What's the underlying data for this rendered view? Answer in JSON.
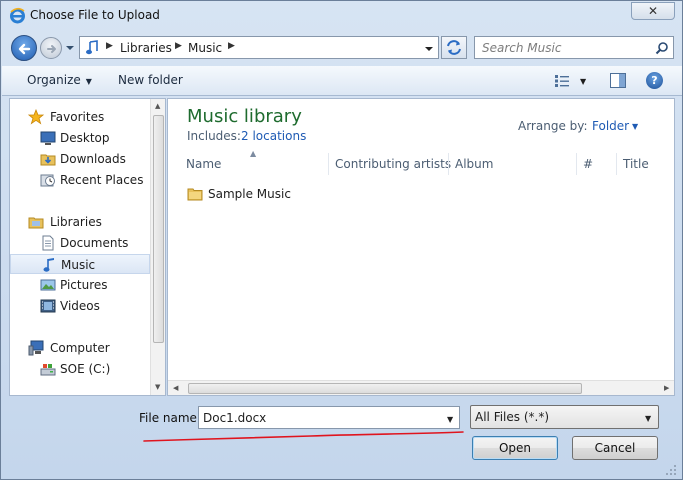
{
  "window": {
    "title": "Choose File to Upload",
    "close_symbol": "✕"
  },
  "address": {
    "crumbs": [
      "Libraries",
      "Music"
    ],
    "search_placeholder": "Search Music"
  },
  "toolbar": {
    "organize": "Organize",
    "new_folder": "New folder",
    "help_symbol": "?"
  },
  "nav": {
    "items": [
      {
        "label": "Favorites",
        "icon": "star-icon"
      },
      {
        "label": "Desktop",
        "icon": "desktop-icon"
      },
      {
        "label": "Downloads",
        "icon": "downloads-folder-icon"
      },
      {
        "label": "Recent Places",
        "icon": "recent-places-icon"
      },
      {
        "label": "Libraries",
        "icon": "libraries-icon"
      },
      {
        "label": "Documents",
        "icon": "documents-icon"
      },
      {
        "label": "Music",
        "icon": "music-note-icon"
      },
      {
        "label": "Pictures",
        "icon": "pictures-icon"
      },
      {
        "label": "Videos",
        "icon": "videos-icon"
      },
      {
        "label": "Computer",
        "icon": "computer-icon"
      },
      {
        "label": "SOE (C:)",
        "icon": "drive-icon"
      }
    ],
    "selected": "Music"
  },
  "library": {
    "title": "Music library",
    "includes_label": "Includes:",
    "includes_link": "2 locations",
    "arrange_label": "Arrange by:",
    "arrange_value": "Folder"
  },
  "columns": [
    "Name",
    "Contributing artists",
    "Album",
    "#",
    "Title"
  ],
  "files": [
    {
      "name": "Sample Music",
      "type": "folder"
    }
  ],
  "bottom": {
    "file_name_label": "File name:",
    "file_name_value": "Doc1.docx",
    "file_type_value": "All Files (*.*)",
    "open_label": "Open",
    "cancel_label": "Cancel"
  },
  "colors": {
    "library_title": "#1e6b2e",
    "link": "#1f5bb4",
    "annotation": "#e0141e"
  }
}
